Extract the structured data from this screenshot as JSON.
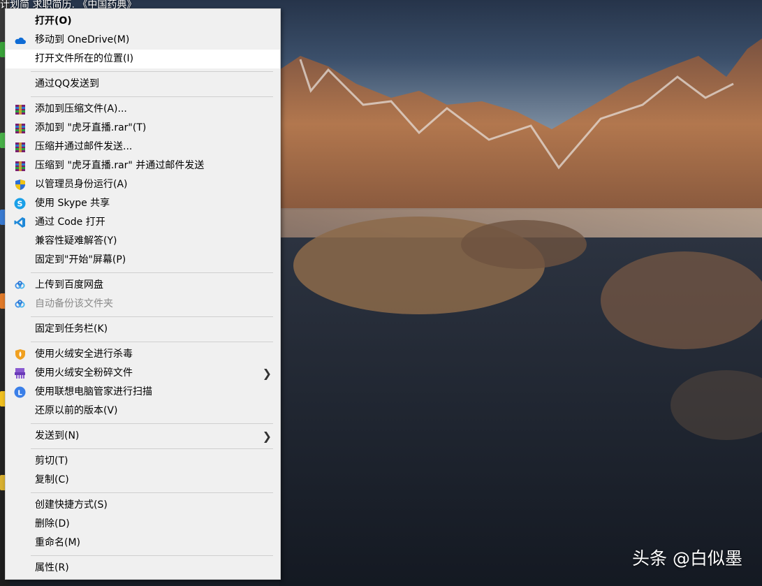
{
  "desktop": {
    "top_text": "计划简   求职简历.  《中国药典》",
    "watermark": "头条 @白似墨"
  },
  "context_menu": {
    "items": [
      {
        "id": "open",
        "label": "打开(O)",
        "icon": "none",
        "bold": true
      },
      {
        "id": "onedrive",
        "label": "移动到 OneDrive(M)",
        "icon": "onedrive-cloud-icon"
      },
      {
        "id": "open-location",
        "label": "打开文件所在的位置(I)",
        "icon": "none",
        "highlighted": true
      },
      {
        "separator": true
      },
      {
        "id": "send-qq",
        "label": "通过QQ发送到",
        "icon": "none"
      },
      {
        "separator": true
      },
      {
        "id": "add-archive",
        "label": "添加到压缩文件(A)...",
        "icon": "winrar-icon"
      },
      {
        "id": "add-rar",
        "label": "添加到 \"虎牙直播.rar\"(T)",
        "icon": "winrar-icon"
      },
      {
        "id": "compress-email",
        "label": "压缩并通过邮件发送...",
        "icon": "winrar-icon"
      },
      {
        "id": "compress-rar-email",
        "label": "压缩到 \"虎牙直播.rar\" 并通过邮件发送",
        "icon": "winrar-icon"
      },
      {
        "id": "run-admin",
        "label": "以管理员身份运行(A)",
        "icon": "uac-shield-icon"
      },
      {
        "id": "skype-share",
        "label": "使用 Skype 共享",
        "icon": "skype-icon"
      },
      {
        "id": "open-code",
        "label": "通过 Code 打开",
        "icon": "vscode-icon"
      },
      {
        "id": "compat",
        "label": "兼容性疑难解答(Y)",
        "icon": "none"
      },
      {
        "id": "pin-start",
        "label": "固定到\"开始\"屏幕(P)",
        "icon": "none"
      },
      {
        "separator": true
      },
      {
        "id": "baidu-upload",
        "label": "上传到百度网盘",
        "icon": "baidu-netdisk-icon"
      },
      {
        "id": "baidu-backup",
        "label": "自动备份该文件夹",
        "icon": "baidu-netdisk-icon",
        "disabled": true
      },
      {
        "separator": true
      },
      {
        "id": "pin-taskbar",
        "label": "固定到任务栏(K)",
        "icon": "none"
      },
      {
        "separator": true
      },
      {
        "id": "huorong-scan",
        "label": "使用火绒安全进行杀毒",
        "icon": "huorong-shield-icon"
      },
      {
        "id": "huorong-shred",
        "label": "使用火绒安全粉碎文件",
        "icon": "huorong-shredder-icon",
        "submenu": true
      },
      {
        "id": "lenovo-scan",
        "label": "使用联想电脑管家进行扫描",
        "icon": "lenovo-icon"
      },
      {
        "id": "restore",
        "label": "还原以前的版本(V)",
        "icon": "none"
      },
      {
        "separator": true
      },
      {
        "id": "send-to",
        "label": "发送到(N)",
        "icon": "none",
        "submenu": true
      },
      {
        "separator": true
      },
      {
        "id": "cut",
        "label": "剪切(T)",
        "icon": "none"
      },
      {
        "id": "copy",
        "label": "复制(C)",
        "icon": "none"
      },
      {
        "separator": true
      },
      {
        "id": "shortcut",
        "label": "创建快捷方式(S)",
        "icon": "none"
      },
      {
        "id": "delete",
        "label": "删除(D)",
        "icon": "none"
      },
      {
        "id": "rename",
        "label": "重命名(M)",
        "icon": "none"
      },
      {
        "separator": true
      },
      {
        "id": "properties",
        "label": "属性(R)",
        "icon": "none"
      }
    ],
    "submenu_glyph": "❯"
  },
  "colors": {
    "menu_bg": "#f0f0f0",
    "highlight_bg": "#ffffff",
    "separator": "#cfcfcf",
    "disabled_text": "#8a8a8a"
  }
}
